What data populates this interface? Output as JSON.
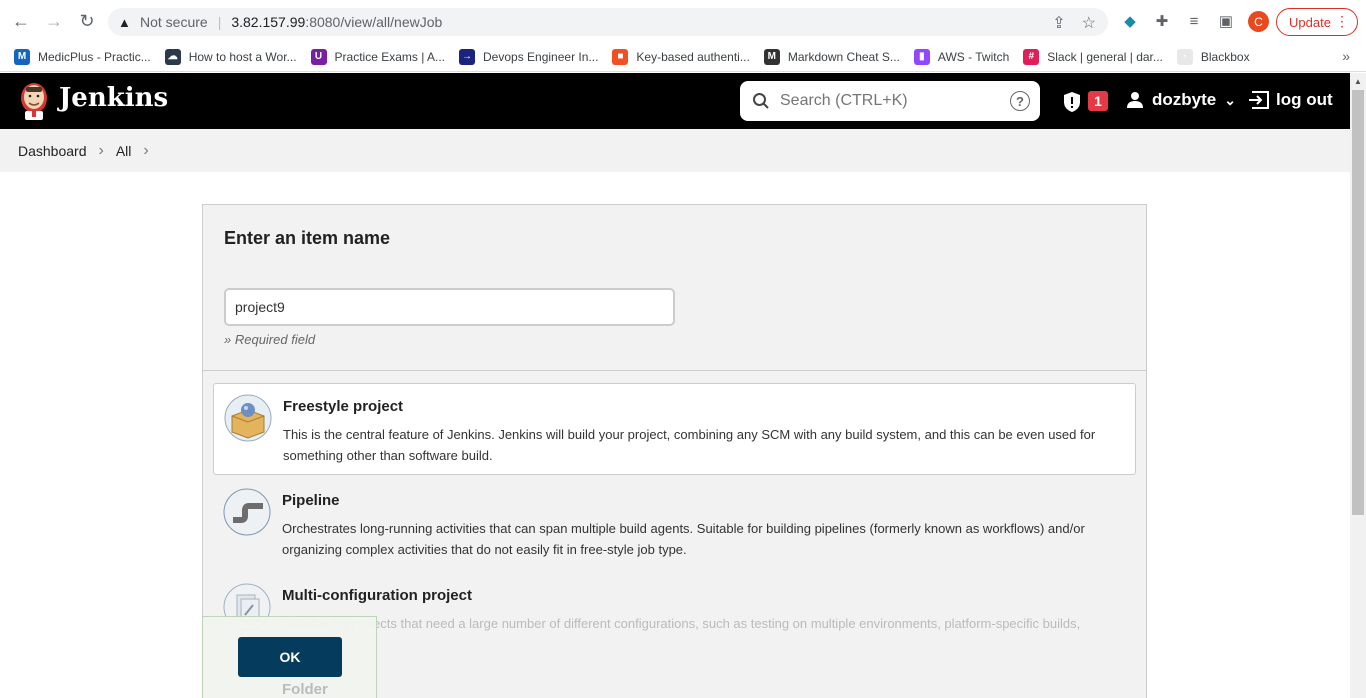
{
  "browser": {
    "not_secure": "Not secure",
    "url_host": "3.82.157.99",
    "url_path": ":8080/view/all/newJob",
    "update_label": "Update",
    "profile_initial": "C"
  },
  "bookmarks": [
    {
      "label": "MedicPlus - Practic...",
      "color": "#1565c0",
      "glyph": "M"
    },
    {
      "label": "How to host a Wor...",
      "color": "#2b3a4a",
      "glyph": "☁"
    },
    {
      "label": "Practice Exams | A...",
      "color": "#7b1fa2",
      "glyph": "U"
    },
    {
      "label": "Devops Engineer In...",
      "color": "#1a237e",
      "glyph": "→"
    },
    {
      "label": "Key-based authenti...",
      "color": "#f25022",
      "glyph": "■"
    },
    {
      "label": "Markdown Cheat S...",
      "color": "#333333",
      "glyph": "M"
    },
    {
      "label": "AWS - Twitch",
      "color": "#9146ff",
      "glyph": "▮"
    },
    {
      "label": "Slack | general | dar...",
      "color": "#e01e5a",
      "glyph": "#"
    },
    {
      "label": "Blackbox",
      "color": "#e8e8e8",
      "glyph": "·"
    }
  ],
  "jenkins": {
    "title": "Jenkins",
    "search_placeholder": "Search (CTRL+K)",
    "alert_count": "1",
    "username": "dozbyte",
    "logout_label": "log out"
  },
  "breadcrumb": [
    "Dashboard",
    "All"
  ],
  "form": {
    "title": "Enter an item name",
    "item_name": "project9",
    "required_note": "» Required field",
    "ok_label": "OK"
  },
  "item_types": [
    {
      "title": "Freestyle project",
      "desc": "This is the central feature of Jenkins. Jenkins will build your project, combining any SCM with any build system, and this can be even used for something other than software build."
    },
    {
      "title": "Pipeline",
      "desc": "Orchestrates long-running activities that can span multiple build agents. Suitable for building pipelines (formerly known as workflows) and/or organizing complex activities that do not easily fit in free-style job type."
    },
    {
      "title": "Multi-configuration project",
      "desc": "Suitable for projects that need a large number of different configurations, such as testing on multiple environments, platform-specific builds,"
    },
    {
      "title": "Folder"
    }
  ],
  "colors": {
    "header_bg": "#000000",
    "ok_button": "#053c5e",
    "badge": "#e63946"
  }
}
